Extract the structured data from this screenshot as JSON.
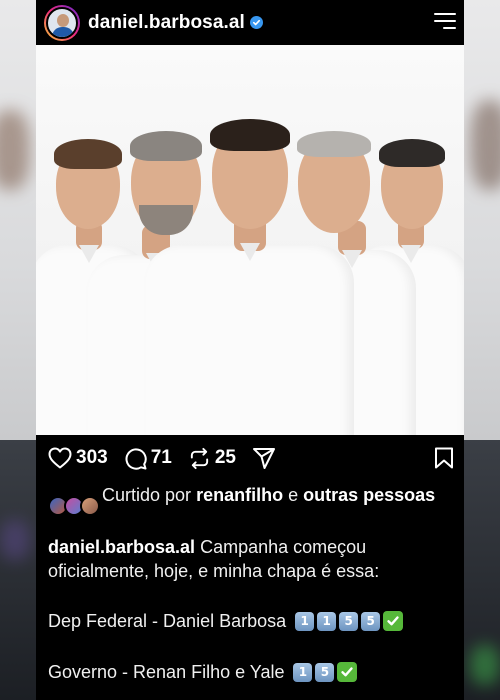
{
  "header": {
    "username": "daniel.barbosa.al",
    "verified": true
  },
  "actions": {
    "likes_count": "303",
    "comments_count": "71",
    "reposts_count": "25"
  },
  "liked_by": {
    "prefix": "Curtido por",
    "user": "renanfilho",
    "conjunction": "e",
    "others": "outras pessoas"
  },
  "caption": {
    "author": "daniel.barbosa.al",
    "text": "Campanha começou oficialmente, hoje, e minha chapa é essa:",
    "line1_text": "Dep Federal - Daniel Barbosa",
    "line1_digits": [
      "1",
      "1",
      "5",
      "5"
    ],
    "line2_text": "Governo - Renan Filho e Yale",
    "line2_digits": [
      "1",
      "5"
    ]
  },
  "colors": {
    "background": "#000000",
    "text": "#f0f0f0",
    "verified_badge": "#3897f0",
    "keycap": "#6d94c0",
    "checkmark_box": "#56b83a"
  },
  "icons": [
    "menu-icon",
    "heart-icon",
    "comment-icon",
    "repost-icon",
    "share-icon",
    "bookmark-icon",
    "verified-icon",
    "checkmark-icon"
  ]
}
